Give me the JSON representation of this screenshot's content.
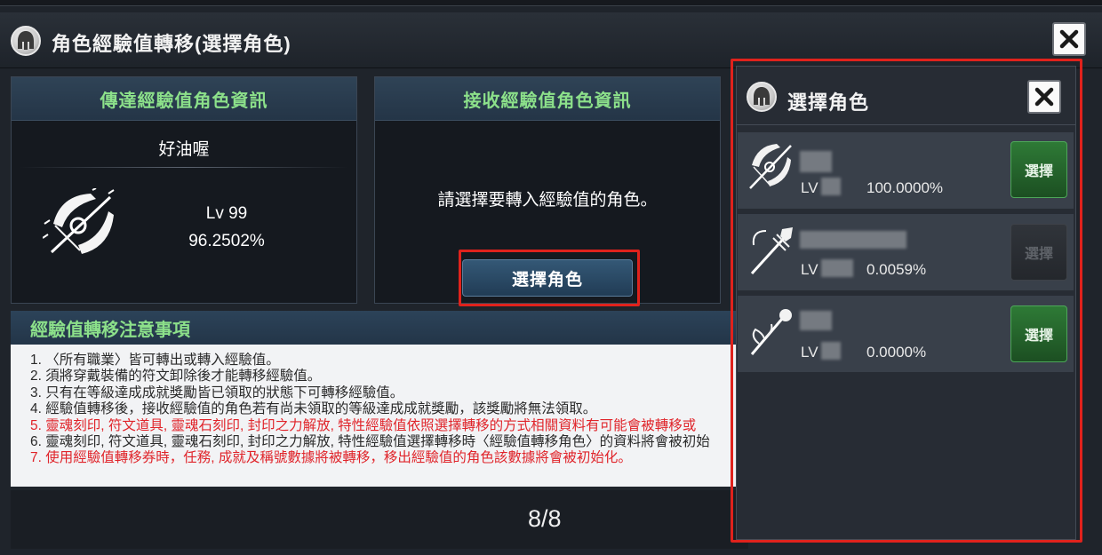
{
  "window": {
    "title": "角色經驗值轉移(選擇角色)"
  },
  "sender_panel": {
    "header": "傳達經驗值角色資訊",
    "character_name": "好油喔",
    "level": "Lv 99",
    "exp_percent": "96.2502%",
    "class_icon": "bow-icon"
  },
  "receiver_panel": {
    "header": "接收經驗值角色資訊",
    "prompt": "請選擇要轉入經驗值的角色。",
    "select_button_label": "選擇角色"
  },
  "notice": {
    "header": "經驗值轉移注意事項",
    "items": [
      {
        "text": "1. 〈所有職業〉皆可轉出或轉入經驗值。",
        "color": "#2a2a2a"
      },
      {
        "text": "2. 須將穿戴裝備的符文卸除後才能轉移經驗值。",
        "color": "#2a2a2a"
      },
      {
        "text": "3. 只有在等級達成成就獎勵皆已領取的狀態下可轉移經驗值。",
        "color": "#2a2a2a"
      },
      {
        "text": "4. 經驗值轉移後，接收經驗值的角色若有尚未領取的等級達成成就獎勵，該獎勵將無法領取。",
        "color": "#2a2a2a"
      },
      {
        "text": "5. 靈魂刻印, 符文道具, 靈魂石刻印, 封印之力解放, 特性經驗值依照選擇轉移的方式相關資料有可能會被轉移或",
        "color": "#e0242a"
      },
      {
        "text": "6. 靈魂刻印, 符文道具, 靈魂石刻印, 封印之力解放, 特性經驗值選擇轉移時〈經驗值轉移角色〉的資料將會被初始",
        "color": "#2a2a2a"
      },
      {
        "text": "7. 使用經驗值轉移券時，任務, 成就及稱號數據將被轉移，移出經驗值的角色該數據將會被初始化。",
        "color": "#e0242a"
      }
    ]
  },
  "pagination": {
    "label": "8/8"
  },
  "popup": {
    "title": "選擇角色",
    "characters": [
      {
        "level_prefix": "LV",
        "exp_percent": "100.0000%",
        "select_label": "選擇",
        "enabled": true,
        "class_icon": "bow-icon"
      },
      {
        "level_prefix": "LV",
        "exp_percent": "0.0059%",
        "select_label": "選擇",
        "enabled": false,
        "class_icon": "spear-icon"
      },
      {
        "level_prefix": "LV",
        "exp_percent": "0.0000%",
        "select_label": "選擇",
        "enabled": true,
        "class_icon": "staff-icon"
      }
    ]
  },
  "colors": {
    "highlight_red": "#e0221c",
    "header_green_text": "#8ce08a",
    "select_green": "#2e7a36"
  }
}
